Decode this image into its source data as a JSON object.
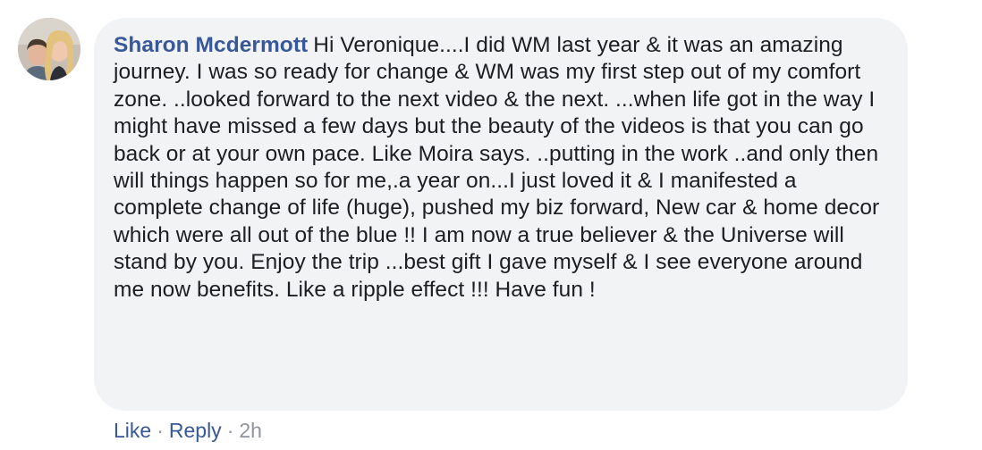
{
  "comment": {
    "author": "Sharon Mcdermott",
    "text": "Hi Veronique....I did WM last year & it was an amazing journey. I was so ready for change & WM was my first step out of my comfort zone. ..looked forward to the next video & the next. ...when life got in the way I might have missed a few days but the beauty of the videos is that you can go back or at your own pace. Like Moira says. ..putting in the work ..and only then will things happen so for me,.a year on...I just loved it & I manifested a complete change of life (huge), pushed my biz forward, New car & home decor which were all out of the blue !! I am now a true believer & the Universe will stand by you. Enjoy the trip ...best gift I gave myself & I see everyone around me now benefits. Like a ripple effect !!! Have fun !",
    "avatar_icon": "profile-photo"
  },
  "actions": {
    "like_label": "Like",
    "separator": "·",
    "reply_label": "Reply",
    "timestamp": "2h"
  },
  "colors": {
    "author": "#385898",
    "text": "#1c1e21",
    "bubble": "#f2f3f5",
    "meta": "#90949c"
  }
}
